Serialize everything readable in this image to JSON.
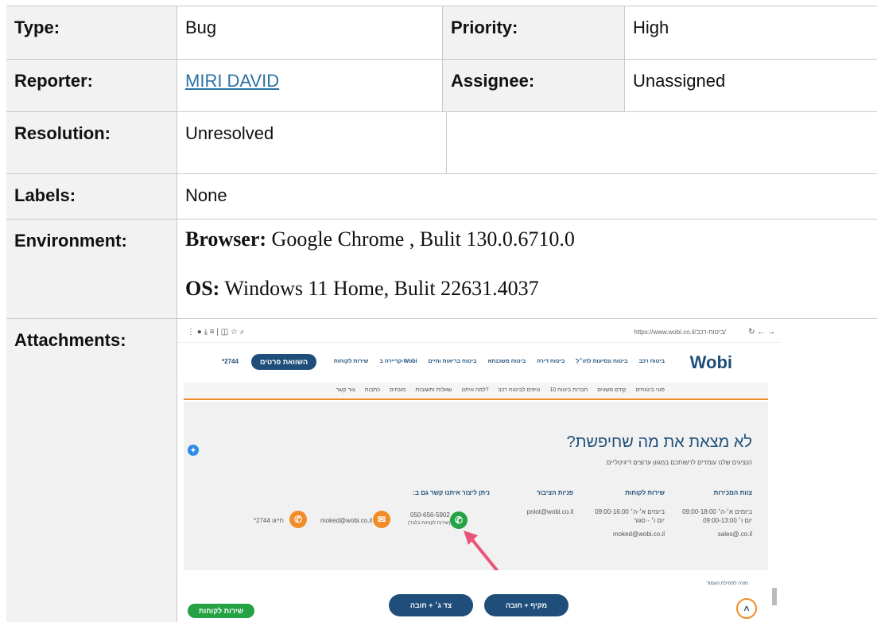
{
  "fields": {
    "type": {
      "label": "Type:",
      "value": "Bug"
    },
    "priority": {
      "label": "Priority:",
      "value": "High"
    },
    "reporter": {
      "label": "Reporter:",
      "value": "MIRI DAVID"
    },
    "assignee": {
      "label": "Assignee:",
      "value": "Unassigned"
    },
    "resolution": {
      "label": "Resolution:",
      "value": "Unresolved"
    },
    "labels": {
      "label": "Labels:",
      "value": "None"
    },
    "environment": {
      "label": "Environment:",
      "browser_key": "Browser:",
      "browser_value": " Google Chrome , Bulit 130.0.6710.0",
      "os_key": "OS:",
      "os_value": " Windows 11 Home, Bulit 22631.4037"
    },
    "attachments": {
      "label": "Attachments:"
    }
  },
  "screenshot": {
    "url": "https://www.wobi.co.il/ביטוח-רכב/",
    "logo": "Wobi",
    "phone": "*2744",
    "cta": "השוואת פרטים",
    "nav_items": [
      "ביטוח רכב",
      "ביטוח ונסיעות לחו״ל",
      "ביטוח דירה",
      "ביטוח משכנתא",
      "ביטוח בריאות וחיים",
      "קריירה ב-Wobi",
      "שירות לקוחות"
    ],
    "sub_items": [
      "סוגי ביטוחים",
      "קודם משווים",
      "10 חברות ביטוח",
      "טיפים לביטוח רכב",
      "למה איתנו?",
      "שאלות ותשובות",
      "מונחים",
      "כתבות",
      "צור קשר"
    ],
    "headline": "לא מצאת את מה שחיפשת?",
    "subhead": "הנציגים שלנו עומדים לרשותכם במגוון ערוצים דיגיטליים:",
    "columns": [
      "צוות המכירות",
      "שירות לקוחות",
      "פניות הציבור",
      "ניתן ליצור איתנו קשר גם ב:"
    ],
    "sales_hours": "ביומים א׳-ה׳ 09:00-18:00",
    "sales_fri": "יום ו׳ 09:00-13:00",
    "sales_mail": "sales@.co.il",
    "service_hours": "ביומים א׳-ה׳ 09:00-16:00",
    "service_fri": "יום ו׳ - סגור",
    "service_mail": "moked@wobi.co.il",
    "public_mail": "pniot@wobi.co.il",
    "whatsapp_phone": "050-656-5902",
    "whatsapp_note": "(שירות לקוחות בלבד)",
    "email_contact": "moked@wobi.co.il",
    "phone_contact": "*2744 חייגו",
    "footer_btn1": "מקיף + חובה",
    "footer_btn2": "צד ג׳ + חובה",
    "service_btn": "שירות לקוחות",
    "back_to_top": "חזרה לתחילת העמוד",
    "colors": {
      "navy": "#1e4e79",
      "orange": "#f28c28",
      "green": "#25a244",
      "arrow": "#e8547a"
    }
  }
}
